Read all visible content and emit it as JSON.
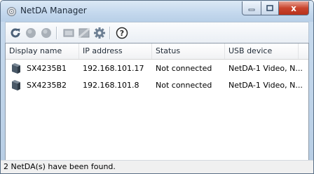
{
  "window": {
    "title": "NetDA Manager",
    "close_glyph": "x",
    "icon": "gear-app-icon"
  },
  "toolbar": {
    "buttons": [
      {
        "name": "refresh",
        "icon": "refresh-icon",
        "enabled": true
      },
      {
        "name": "connect",
        "icon": "circle-icon",
        "enabled": false
      },
      {
        "name": "disconnect",
        "icon": "circle-icon",
        "enabled": false
      },
      {
        "name": "display",
        "icon": "screen-icon",
        "enabled": false
      },
      {
        "name": "fullscreen",
        "icon": "screen-icon",
        "enabled": false
      },
      {
        "name": "settings",
        "icon": "gear-icon",
        "enabled": true
      },
      {
        "name": "help",
        "icon": "help-icon",
        "enabled": true
      }
    ],
    "help_glyph": "?"
  },
  "list": {
    "columns": [
      "Display name",
      "IP address",
      "Status",
      "USB device"
    ],
    "rows": [
      {
        "display_name": "SX4235B1",
        "ip": "192.168.101.17",
        "status": "Not connected",
        "usb": "NetDA-1 Video, N..."
      },
      {
        "display_name": "SX4235B2",
        "ip": "192.168.101.8",
        "status": "Not connected",
        "usb": "NetDA-1 Video, N..."
      }
    ]
  },
  "statusbar": {
    "text": "2 NetDA(s) have been found."
  },
  "colors": {
    "accent": "#2e6fb4",
    "close_button": "#c9442d"
  }
}
